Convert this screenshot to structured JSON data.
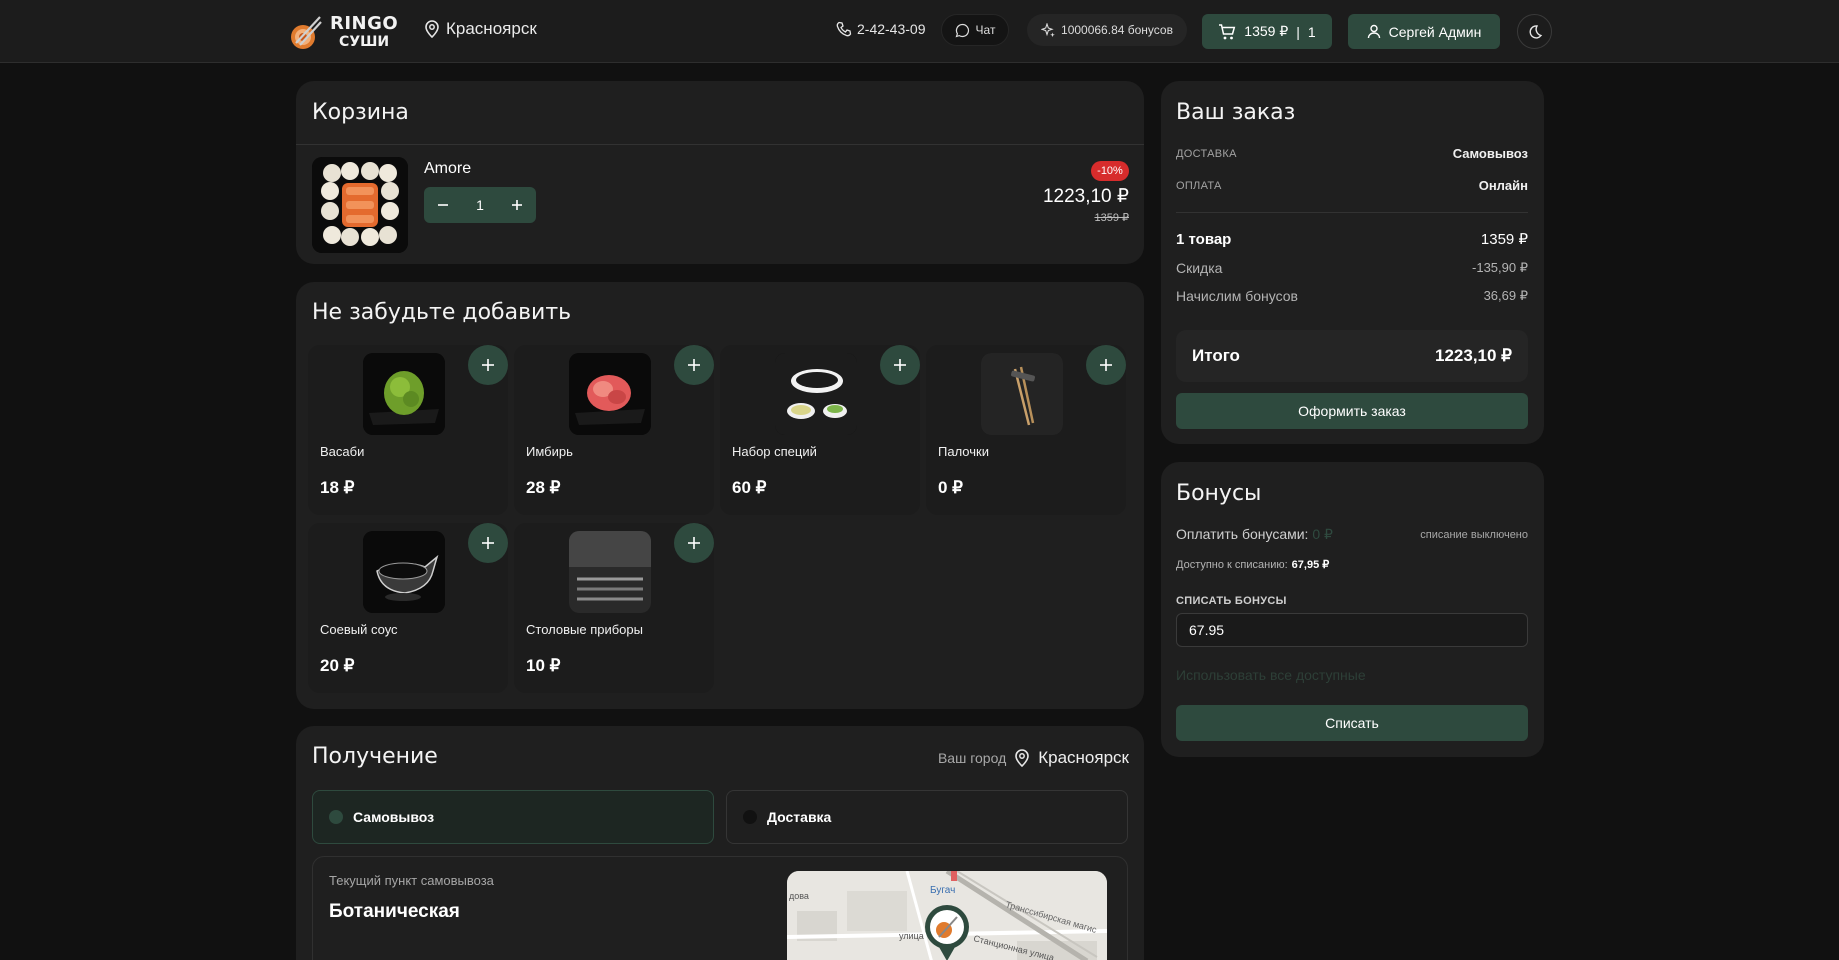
{
  "header": {
    "logo_line1": "RINGO",
    "logo_line2": "СУШИ",
    "city": "Красноярск",
    "phone": "2-42-43-09",
    "chat": "Чат",
    "bonuses": "1000066.84 бонусов",
    "cart_sum": "1359 ₽",
    "cart_sep": "|",
    "cart_count": "1",
    "user": "Сергей Админ"
  },
  "cart": {
    "title": "Корзина",
    "items": [
      {
        "name": "Amore",
        "qty": "1",
        "discount": "-10%",
        "price": "1223,10 ₽",
        "old_price": "1359 ₽"
      }
    ]
  },
  "upsell": {
    "title": "Не забудьте добавить",
    "items": [
      {
        "name": "Васаби",
        "price": "18 ₽"
      },
      {
        "name": "Имбирь",
        "price": "28 ₽"
      },
      {
        "name": "Набор специй",
        "price": "60 ₽"
      },
      {
        "name": "Палочки",
        "price": "0 ₽"
      },
      {
        "name": "Соевый соус",
        "price": "20 ₽"
      },
      {
        "name": "Столовые приборы",
        "price": "10 ₽"
      }
    ]
  },
  "receive": {
    "title": "Получение",
    "your_city_label": "Ваш город",
    "city": "Красноярск",
    "options": [
      "Самовывоз",
      "Доставка"
    ],
    "selected": "Самовывоз",
    "pickup_label": "Текущий пункт самовывоза",
    "pickup_name": "Ботаническая",
    "map_labels": [
      "Бугач",
      "Станционная улица",
      "Транссибирская магис",
      "улица",
      "дова"
    ]
  },
  "order": {
    "title": "Ваш заказ",
    "delivery_label": "ДОСТАВКА",
    "delivery_value": "Самовывоз",
    "payment_label": "ОПЛАТА",
    "payment_value": "Онлайн",
    "items_label": "1 товар",
    "items_value": "1359 ₽",
    "discount_label": "Скидка",
    "discount_value": "-135,90 ₽",
    "bonus_label": "Начислим бонусов",
    "bonus_value": "36,69 ₽",
    "total_label": "Итого",
    "total_value": "1223,10 ₽",
    "checkout": "Оформить заказ"
  },
  "bonus": {
    "title": "Бонусы",
    "pay_label": "Оплатить бонусами:",
    "pay_value": "0 ₽",
    "status": "списание выключено",
    "available_label": "Доступно к списанию:",
    "available_value": "67,95 ₽",
    "input_label": "СПИСАТЬ БОНУСЫ",
    "input_value": "67.95",
    "use_all": "Использовать все доступные",
    "write_off": "Списать"
  },
  "colors": {
    "accent": "#2e4a3e",
    "badge": "#d72c2c",
    "bg": "#111111",
    "panel": "#1f1f1f"
  }
}
